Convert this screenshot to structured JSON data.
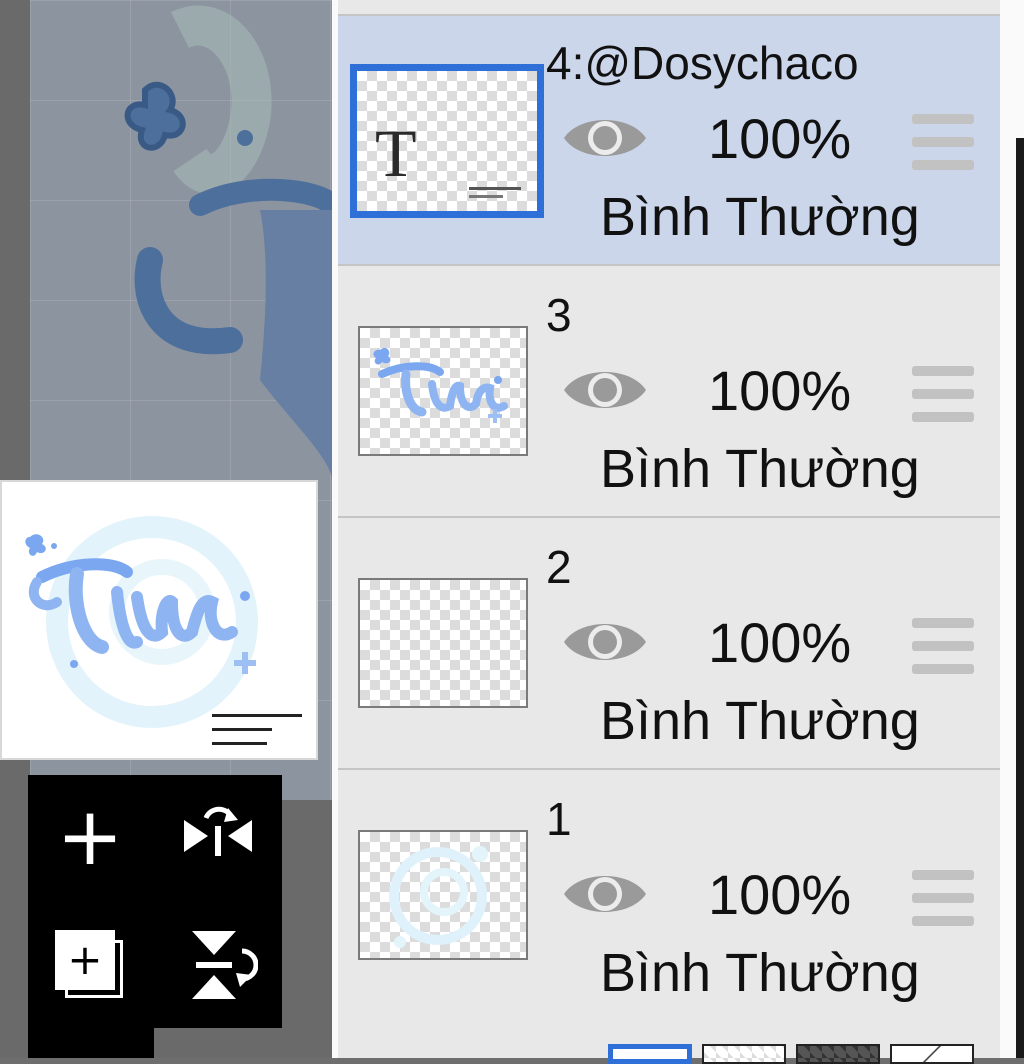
{
  "layers": [
    {
      "name": "4:@Dosychaco",
      "opacity": "100%",
      "blend": "Bình Thường",
      "thumb_letter": "T",
      "selected": true
    },
    {
      "name": "3",
      "opacity": "100%",
      "blend": "Bình Thường"
    },
    {
      "name": "2",
      "opacity": "100%",
      "blend": "Bình Thường"
    },
    {
      "name": "1",
      "opacity": "100%",
      "blend": "Bình Thường"
    }
  ],
  "tools": {
    "add_symbol": "+",
    "add_copy_symbol": "+"
  },
  "colors": {
    "selected_layer_bg": "#cbd6ea",
    "selection_border": "#2f6fd8",
    "panel_bg": "#e8e8e8",
    "artwork_blue": "#7aa7f0"
  }
}
